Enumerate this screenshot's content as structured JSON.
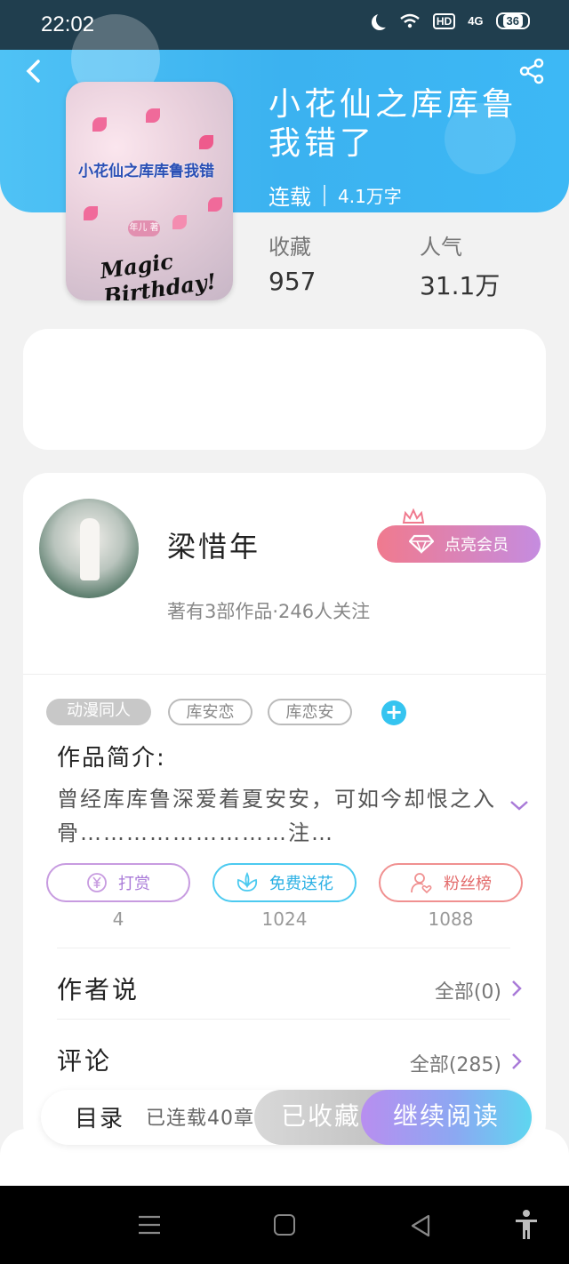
{
  "status_bar": {
    "time": "22:02",
    "network": "4G",
    "hd": "HD",
    "battery": "36"
  },
  "book": {
    "title": "小花仙之库库鲁我错了",
    "status": "连载",
    "word_count": "4.1万字",
    "cover_text": "小花仙之库库鲁我错",
    "cover_author": "年儿 著",
    "cover_caption": "Magic Birthday!"
  },
  "stats": [
    {
      "label": "收藏",
      "value": "957"
    },
    {
      "label": "人气",
      "value": "31.1万"
    }
  ],
  "author": {
    "name": "梁惜年",
    "stats": "著有3部作品·246人关注",
    "vip_label": "点亮会员"
  },
  "tags": [
    "动漫同人",
    "库安恋",
    "库恋安"
  ],
  "tag_add": "+",
  "intro": {
    "label": "作品简介:",
    "text": "曾经库库鲁深爱着夏安安，可如今却恨之入骨………………………注…"
  },
  "actions": [
    {
      "label": "打赏",
      "count": "4",
      "icon": "yen-coin-icon"
    },
    {
      "label": "免费送花",
      "count": "1024",
      "icon": "flower-icon"
    },
    {
      "label": "粉丝榜",
      "count": "1088",
      "icon": "user-heart-icon"
    }
  ],
  "rows": [
    {
      "label": "作者说",
      "right": "全部(0)"
    },
    {
      "label": "评论",
      "right": "全部(285)"
    }
  ],
  "bottom": {
    "toc_label": "目录",
    "toc_status": "已连载40章",
    "collected_label": "已收藏",
    "read_label": "继续阅读"
  },
  "colors": {
    "header_blue": "#3bb2f0",
    "vip_start": "#f07a8e",
    "vip_end": "#c58ce0",
    "tag_add": "#35c4f0",
    "read_start": "#b88ef0",
    "read_end": "#5ed6f0"
  }
}
